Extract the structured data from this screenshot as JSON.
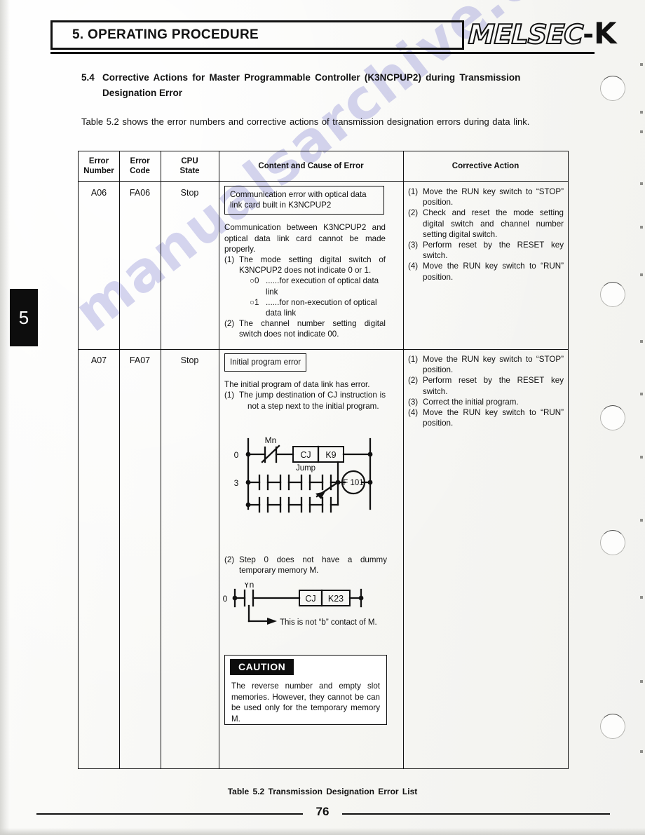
{
  "header": {
    "title": "5. OPERATING PROCEDURE",
    "logo_outline": "MELSEC",
    "logo_dash": "-",
    "logo_k": "K"
  },
  "chapter_tab": "5",
  "section": {
    "number": "5.4",
    "title_line1": "Corrective Actions for Master Programmable Controller (K3NCPUP2) during Transmission",
    "title_line2": "Designation Error",
    "intro": "Table 5.2 shows the error numbers and corrective actions of transmission designation errors during data link."
  },
  "table": {
    "headers": {
      "error_number": "Error\nNumber",
      "error_number_l1": "Error",
      "error_number_l2": "Number",
      "error_code_l1": "Error",
      "error_code_l2": "Code",
      "cpu_state_l1": "CPU",
      "cpu_state_l2": "State",
      "content": "Content and Cause of Error",
      "corrective": "Corrective Action"
    },
    "rows": [
      {
        "error_number": "A06",
        "error_code": "FA06",
        "cpu_state": "Stop",
        "content_boxed": "Communication error with optical data link card built in K3NCPUP2",
        "content_body": "Communication between K3NCPUP2 and optical data link card cannot be made properly.",
        "content_items": [
          {
            "marker": "(1)",
            "text": "The mode setting digital switch of K3NCPUP2 does not indicate 0 or 1.",
            "subitems": [
              {
                "marker": "○0",
                "text": "......for execution of optical data link"
              },
              {
                "marker": "○1",
                "text": "......for non-execution of optical data link"
              }
            ]
          },
          {
            "marker": "(2)",
            "text": "The channel number setting digital switch does not indicate 00.",
            "subitems": []
          }
        ],
        "corrective_items": [
          {
            "marker": "(1)",
            "text": "Move the RUN key switch to “STOP” position."
          },
          {
            "marker": "(2)",
            "text": "Check and reset the mode setting digital switch and channel number setting digital switch."
          },
          {
            "marker": "(3)",
            "text": "Perform reset by the RESET key switch."
          },
          {
            "marker": "(4)",
            "text": "Move the RUN key switch to “RUN” position."
          }
        ]
      },
      {
        "error_number": "A07",
        "error_code": "FA07",
        "cpu_state": "Stop",
        "content_boxed": "Initial program error",
        "content_body": "The initial program of data link has error.",
        "content_items": [
          {
            "marker": "(1)",
            "text": "The jump destination of CJ instruction is not a step next to the initial program.",
            "subitems": []
          }
        ],
        "content_item2_marker": "(2)",
        "content_item2_text": "Step 0 does not have a dummy temporary memory M.",
        "corrective_items": [
          {
            "marker": "(1)",
            "text": "Move the RUN key switch to “STOP” position."
          },
          {
            "marker": "(2)",
            "text": "Perform reset by the RESET key switch."
          },
          {
            "marker": "(3)",
            "text": "Correct the initial program."
          },
          {
            "marker": "(4)",
            "text": "Move the RUN key switch to “RUN” position."
          }
        ]
      }
    ]
  },
  "ladder1": {
    "step_labels": [
      "0",
      "3"
    ],
    "contact_label": "Mn",
    "instruction": "CJ",
    "operand": "K9",
    "jump_label": "Jump",
    "coil": "F 101"
  },
  "ladder2": {
    "step_label": "0",
    "contact_label": "Yn",
    "instruction": "CJ",
    "operand": "K23",
    "annotation": "This is not “b” contact of M."
  },
  "caution": {
    "label": "CAUTION",
    "text": "The reverse number and empty slot memories. However, they cannot be can be used only for the temporary memory M."
  },
  "caption": "Table 5.2  Transmission Designation Error List",
  "page_number": "76",
  "watermark": "manualsarchive.com",
  "colors": {
    "ink": "#111111",
    "paper": "#fbfbfa",
    "watermark": "#9696d7"
  }
}
